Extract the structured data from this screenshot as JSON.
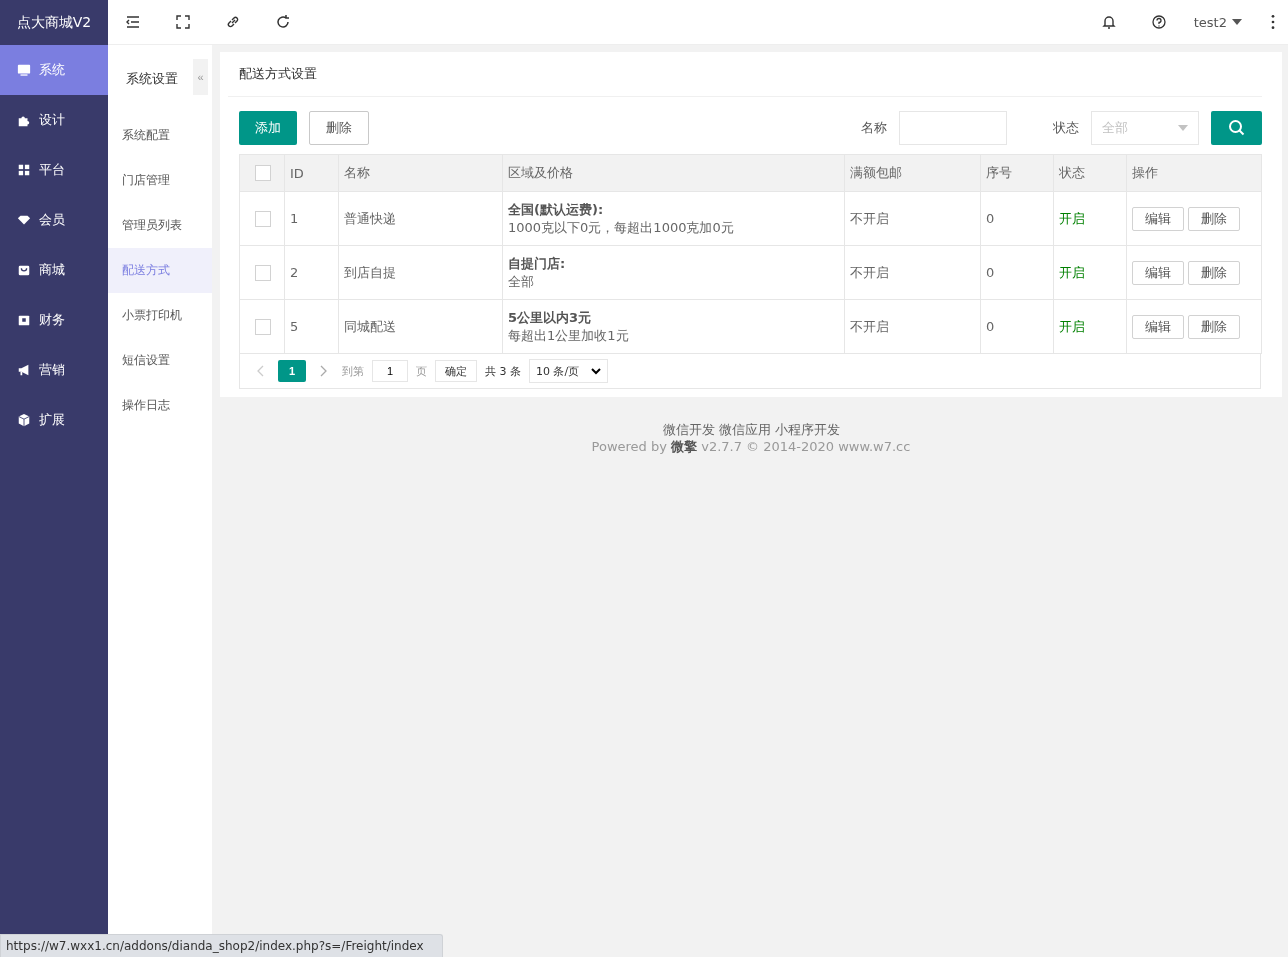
{
  "brand": {
    "title": "点大商城V2"
  },
  "main_nav": [
    {
      "label": "系统",
      "kind": "monitor",
      "selected": true
    },
    {
      "label": "设计",
      "kind": "puzzle",
      "selected": false
    },
    {
      "label": "平台",
      "kind": "grid",
      "selected": false
    },
    {
      "label": "会员",
      "kind": "gem",
      "selected": false
    },
    {
      "label": "商城",
      "kind": "bag",
      "selected": false
    },
    {
      "label": "财务",
      "kind": "wallet",
      "selected": false
    },
    {
      "label": "营销",
      "kind": "megaphone",
      "selected": false
    },
    {
      "label": "扩展",
      "kind": "cube",
      "selected": false
    }
  ],
  "top_bar": {
    "user": "test2"
  },
  "sub_nav": {
    "title": "系统设置",
    "collapse": "«",
    "items": [
      {
        "label": "系统配置",
        "selected": false
      },
      {
        "label": "门店管理",
        "selected": false
      },
      {
        "label": "管理员列表",
        "selected": false
      },
      {
        "label": "配送方式",
        "selected": true
      },
      {
        "label": "小票打印机",
        "selected": false
      },
      {
        "label": "短信设置",
        "selected": false
      },
      {
        "label": "操作日志",
        "selected": false
      }
    ]
  },
  "panel": {
    "title": "配送方式设置",
    "toolbar": {
      "add": "添加",
      "delete": "删除",
      "name_label": "名称",
      "status_label": "状态",
      "status_placeholder": "全部"
    },
    "table": {
      "header_checked": false,
      "columns": [
        "ID",
        "名称",
        "区域及价格",
        "满额包邮",
        "序号",
        "状态",
        "操作"
      ],
      "rows": [
        {
          "checked": false,
          "id": "1",
          "name": "普通快递",
          "region_title": "全国(默认运费):",
          "region_detail": "1000克以下0元，每超出1000克加0元",
          "free_shipping": "不开启",
          "sort": "0",
          "status": "开启",
          "status_on": true,
          "actions": [
            "编辑",
            "删除"
          ]
        },
        {
          "checked": false,
          "id": "2",
          "name": "到店自提",
          "region_title": "自提门店:",
          "region_detail": "全部",
          "free_shipping": "不开启",
          "sort": "0",
          "status": "开启",
          "status_on": true,
          "actions": [
            "编辑",
            "删除"
          ]
        },
        {
          "checked": false,
          "id": "5",
          "name": "同城配送",
          "region_title": "5公里以内3元",
          "region_detail": "每超出1公里加收1元",
          "free_shipping": "不开启",
          "sort": "0",
          "status": "开启",
          "status_on": true,
          "actions": [
            "编辑",
            "删除"
          ]
        }
      ]
    },
    "pagination": {
      "pages": [
        {
          "label": "1",
          "selected": true
        }
      ],
      "goto_label": "到第",
      "goto_value": "1",
      "page_unit": "页",
      "confirm": "确定",
      "total": "共 3 条",
      "page_size": "10 条/页"
    }
  },
  "footer": {
    "links": [
      "微信开发",
      "微信应用",
      "小程序开发"
    ],
    "powered": "Powered by **微擎** v2.7.7 © 2014-2020 www.w7.cc"
  },
  "status_url": "https://w7.wxx1.cn/addons/dianda_shop2/index.php?s=/Freight/index"
}
